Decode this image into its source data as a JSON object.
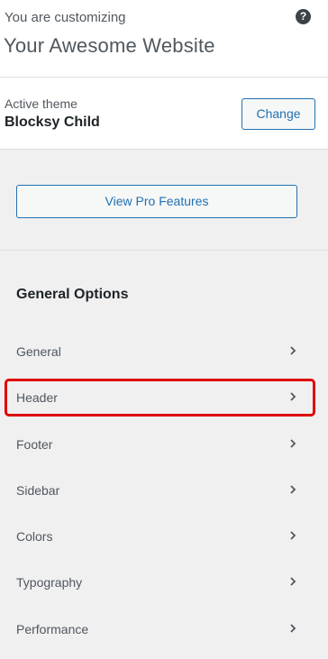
{
  "header": {
    "customizing_label": "You are customizing",
    "site_title": "Your Awesome Website",
    "help_icon": "?"
  },
  "theme": {
    "label": "Active theme",
    "name": "Blocksy Child",
    "change_label": "Change"
  },
  "pro_button": {
    "label": "View Pro Features"
  },
  "section": {
    "title": "General Options",
    "items": [
      {
        "label": "General",
        "icon": "chevron-right-icon"
      },
      {
        "label": "Header",
        "icon": "chevron-right-icon",
        "highlighted": true
      },
      {
        "label": "Footer",
        "icon": "chevron-right-icon"
      },
      {
        "label": "Sidebar",
        "icon": "chevron-right-icon"
      },
      {
        "label": "Colors",
        "icon": "chevron-right-icon"
      },
      {
        "label": "Typography",
        "icon": "chevron-right-icon"
      },
      {
        "label": "Performance",
        "icon": "chevron-right-icon"
      }
    ]
  },
  "colors": {
    "accent": "#2271b1",
    "highlight": "#e00000"
  }
}
